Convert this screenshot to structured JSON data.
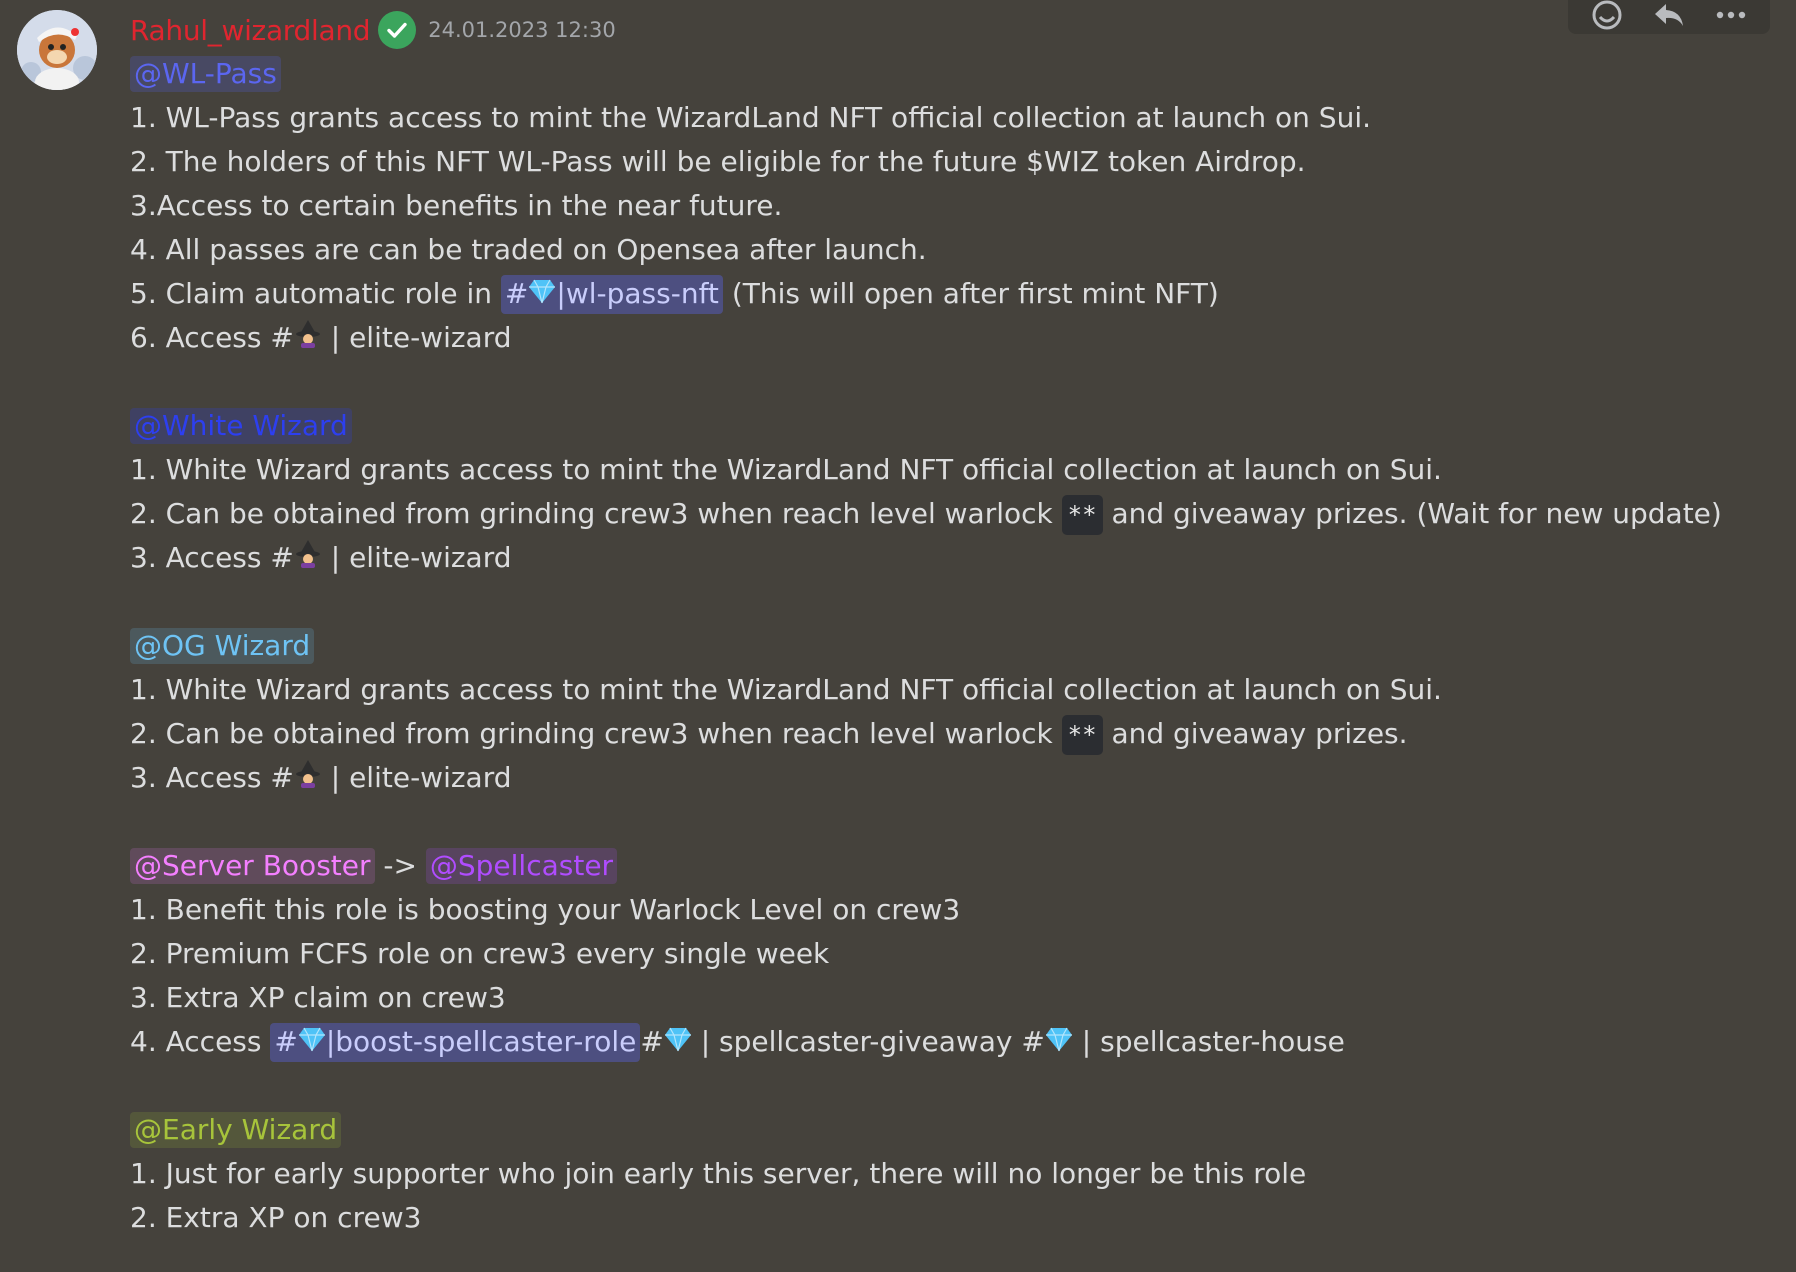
{
  "author": {
    "name": "Rahul_wizardland",
    "timestamp": "24.01.2023 12:30",
    "verified": true,
    "name_color": "#e0252f"
  },
  "toolbar": [
    "add-reaction-icon",
    "reply-icon",
    "more-icon"
  ],
  "colors": {
    "wl_pass": "#5865f2",
    "white_wizard": "#2d3ff0",
    "og_wizard": "#6ec3f4",
    "server_booster": "#f47fff",
    "spellcaster": "#b04cff",
    "early_wizard": "#a7c43b",
    "channel_bg": "#4d4f80"
  },
  "sections": {
    "wl_pass": {
      "mention": "@WL-Pass",
      "l1": "1. WL-Pass grants access to mint the  WizardLand NFT official collection at launch on Sui.",
      "l2": "2. The holders of this NFT WL-Pass will be eligible for the future $WIZ token Airdrop.",
      "l3": "3.Access to certain benefits in the near future.",
      "l4": "4. All passes are can be traded on Opensea after launch.",
      "l5_prefix": "5. Claim automatic role in ",
      "l5_channel": "|wl-pass-nft",
      "l5_suffix": " (This will open after first mint NFT)",
      "l6_prefix": "6. Access #",
      "l6_suffix": "elite-wizard"
    },
    "white_wizard": {
      "mention": "@White Wizard",
      "l1": "1. White Wizard grants access to mint the  WizardLand NFT official collection at launch on Sui.",
      "l2_prefix": "2. Can be obtained from grinding crew3 when reach level warlock ",
      "l2_code": "**",
      "l2_suffix": " and giveaway prizes. (Wait for new update)",
      "l3_prefix": "3. Access #",
      "l3_suffix": "elite-wizard"
    },
    "og_wizard": {
      "mention": "@OG Wizard",
      "l1": "1. White Wizard grants access to mint the  WizardLand NFT official collection at launch on Sui.",
      "l2_prefix": "2. Can be obtained from grinding crew3 when reach level warlock ",
      "l2_code": "**",
      "l2_suffix": " and giveaway prizes.",
      "l3_prefix": "3. Access #",
      "l3_suffix": "elite-wizard"
    },
    "booster": {
      "mention_a": "@Server Booster",
      "arrow": " -> ",
      "mention_b": "@Spellcaster",
      "l1": "1. Benefit this role is boosting your Warlock Level on crew3",
      "l2": "2. Premium FCFS role on crew3 every single week",
      "l3": "3. Extra XP claim on crew3",
      "l4_prefix": "4. Access ",
      "l4_channel": "|boost-spellcaster-role",
      "l4_mid": "spellcaster-giveaway #",
      "l4_suffix": "spellcaster-house"
    },
    "early_wizard": {
      "mention": "@Early Wizard",
      "l1": "1. Just for early supporter who join early this server, there will no longer be this role",
      "l2": "2. Extra XP on crew3"
    }
  }
}
